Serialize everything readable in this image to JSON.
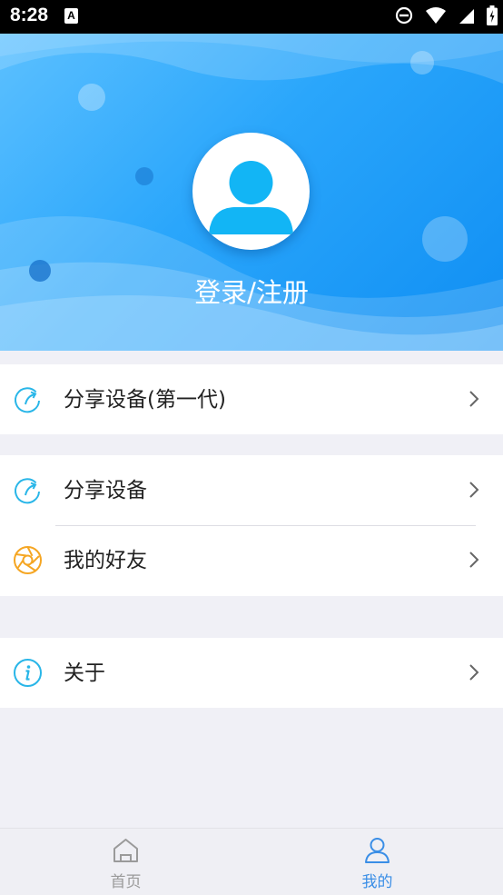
{
  "status_bar": {
    "time": "8:28",
    "app_icon_letter": "A"
  },
  "header": {
    "login_label": "登录/注册",
    "gradient": [
      "#5cc0ff",
      "#0f8ef3"
    ]
  },
  "menu": {
    "share_device_gen1": "分享设备(第一代)",
    "share_device": "分享设备",
    "my_friends": "我的好友",
    "about": "关于"
  },
  "icons": {
    "share": "share-refresh-icon",
    "friends": "aperture-icon",
    "about": "info-icon",
    "chevron": "chevron-right-icon"
  },
  "colors": {
    "icon_cyan": "#29b6e8",
    "icon_orange": "#f5a623",
    "tab_active": "#3a8ee6",
    "tab_inactive": "#9a9a9a"
  },
  "tab_bar": {
    "tabs": [
      {
        "label": "首页",
        "active": false
      },
      {
        "label": "我的",
        "active": true
      }
    ]
  }
}
